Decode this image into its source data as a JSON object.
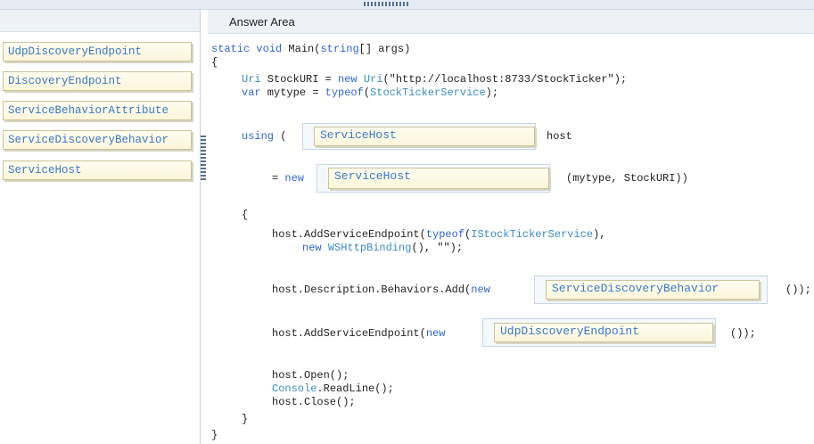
{
  "answer_area": {
    "title": "Answer Area"
  },
  "source_items": [
    "UdpDiscoveryEndpoint",
    "DiscoveryEndpoint",
    "ServiceBehaviorAttribute",
    "ServiceDiscoveryBehavior",
    "ServiceHost"
  ],
  "code": {
    "l1_kw1": "static",
    "l1_kw2": "void",
    "l1_rest": " Main(",
    "l1_kw3": "string",
    "l1_tail": "[] args)",
    "l2": "{",
    "l3_ty": "Uri",
    "l3_a": " StockURI = ",
    "l3_kw": "new",
    "l3_ty2": "Uri",
    "l3_b": "(\"http://localhost:8733/StockTicker\");",
    "l4_kw": "var",
    "l4_a": " mytype = ",
    "l4_kw2": "typeof",
    "l4_b": "(",
    "l4_ty": "StockTickerService",
    "l4_c": ");",
    "l5_kw": "using",
    "l5_a": " (",
    "l5_host": "host",
    "l6_a": "= ",
    "l6_kw": "new",
    "l6_b": "(mytype, StockURI))",
    "l7": "{",
    "l8_a": "host.AddServiceEndpoint(",
    "l8_kw": "typeof",
    "l8_b": "(",
    "l8_ty": "IStockTickerService",
    "l8_c": "),",
    "l9_kw": "new",
    "l9_ty": "WSHttpBinding",
    "l9_a": "(), \"\");",
    "l10_a": "host.Description.Behaviors.Add(",
    "l10_kw": "new",
    "l10_b": "());",
    "l11_a": "host.AddServiceEndpoint(",
    "l11_kw": "new",
    "l11_b": "());",
    "l12": "host.Open();",
    "l13_ty": "Console",
    "l13_a": ".ReadLine();",
    "l14": "host.Close();",
    "l15": "}",
    "l16": "}"
  },
  "targets": {
    "using_type": "ServiceHost",
    "new_type": "ServiceHost",
    "behavior": "ServiceDiscoveryBehavior",
    "endpoint": "UdpDiscoveryEndpoint"
  }
}
